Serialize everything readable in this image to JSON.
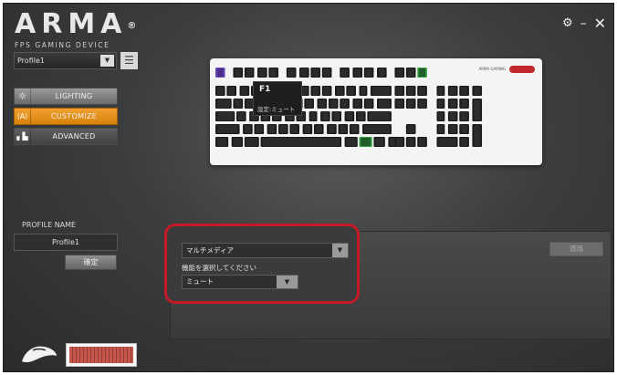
{
  "brand": {
    "logo": "ARMA",
    "logo_mark": "®",
    "tagline": "FPS GAMING DEVICE"
  },
  "window_controls": {
    "settings_icon": "gear-icon",
    "minimize": "–",
    "close": "✕"
  },
  "profile_select": {
    "value": "Profile1",
    "arrow": "▼",
    "menu_icon": "☰"
  },
  "nav": {
    "items": [
      {
        "label": "LIGHTING",
        "icon": "☼",
        "icon_name": "sun-icon"
      },
      {
        "label": "CUSTOMIZE",
        "icon": "⟨A⟩",
        "icon_name": "customize-icon"
      },
      {
        "label": "ADVANCED",
        "icon": "▖▙",
        "icon_name": "bars-icon"
      }
    ],
    "active": "CUSTOMIZE"
  },
  "profile_name": {
    "label": "PROFILE NAME",
    "value": "Profile1",
    "confirm_label": "確定"
  },
  "tooltip": {
    "key": "F1",
    "value": "設定:ミュート"
  },
  "panel": {
    "category_select": "マルチメディア",
    "function_label": "機能を選択してください",
    "function_select": "ミュート",
    "apply_label": "適用",
    "arrow": "▼"
  },
  "colors": {
    "accent": "#e8920f",
    "highlight_frame": "#c41a28",
    "background": "#3c3d3f"
  }
}
